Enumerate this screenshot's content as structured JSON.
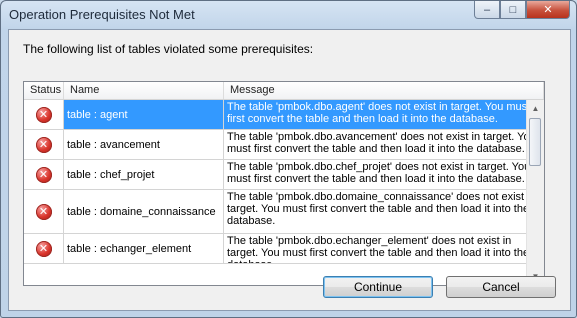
{
  "window": {
    "title": "Operation Prerequisites Not Met"
  },
  "caption": {
    "minimize": "–",
    "maximize": "□",
    "close": "✕"
  },
  "message": "The following list of tables violated some prerequisites:",
  "grid": {
    "columns": {
      "status": "Status",
      "name": "Name",
      "message": "Message"
    },
    "rows": [
      {
        "status_icon": "error-icon",
        "name": "table : agent",
        "message": "The table 'pmbok.dbo.agent' does not exist in target. You must first convert the table and then load it into the database.",
        "selected": true
      },
      {
        "status_icon": "error-icon",
        "name": "table : avancement",
        "message": "The table 'pmbok.dbo.avancement' does not exist in target. You must first convert the table and then load it into the database.",
        "selected": false
      },
      {
        "status_icon": "error-icon",
        "name": "table : chef_projet",
        "message": "The table 'pmbok.dbo.chef_projet' does not exist in target. You must first convert the table and then load it into the database.",
        "selected": false
      },
      {
        "status_icon": "error-icon",
        "name": "table : domaine_connaissance",
        "message": "The table 'pmbok.dbo.domaine_connaissance' does not exist in target. You must first convert the table and then load it into the database.",
        "selected": false
      },
      {
        "status_icon": "error-icon",
        "name": "table : echanger_element",
        "message": "The table 'pmbok.dbo.echanger_element' does not exist in target. You must first convert the table and then load it into the database.",
        "selected": false
      }
    ]
  },
  "buttons": {
    "continue": "Continue",
    "cancel": "Cancel"
  },
  "colors": {
    "selection": "#3399ff",
    "error": "#d9342b",
    "frame": "#c1d5ea"
  }
}
